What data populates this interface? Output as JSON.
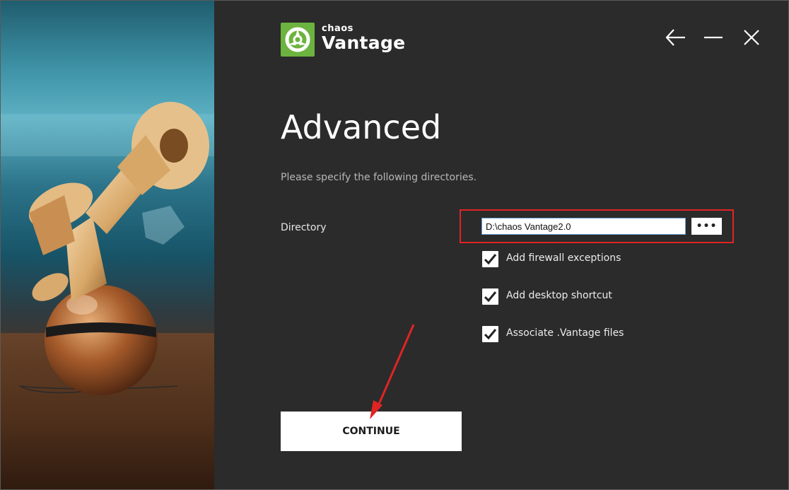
{
  "logo": {
    "small": "chaos",
    "big": "Vantage",
    "color": "#6cb33f"
  },
  "window_controls": {
    "back_icon": "arrow-left-icon",
    "minimize_icon": "minimize-icon",
    "close_icon": "close-icon"
  },
  "page": {
    "title": "Advanced",
    "subtitle": "Please specify the following directories."
  },
  "directory": {
    "label": "Directory",
    "value": "D:\\chaos Vantage2.0",
    "browse_label": "•••"
  },
  "options": [
    {
      "label": "Add firewall exceptions",
      "checked": true
    },
    {
      "label": "Add desktop shortcut",
      "checked": true
    },
    {
      "label": "Associate .Vantage files",
      "checked": true
    }
  ],
  "continue_label": "CONTINUE",
  "colors": {
    "background": "#2b2b2b",
    "highlight": "#e02424",
    "annotation_arrow": "#e02424"
  }
}
